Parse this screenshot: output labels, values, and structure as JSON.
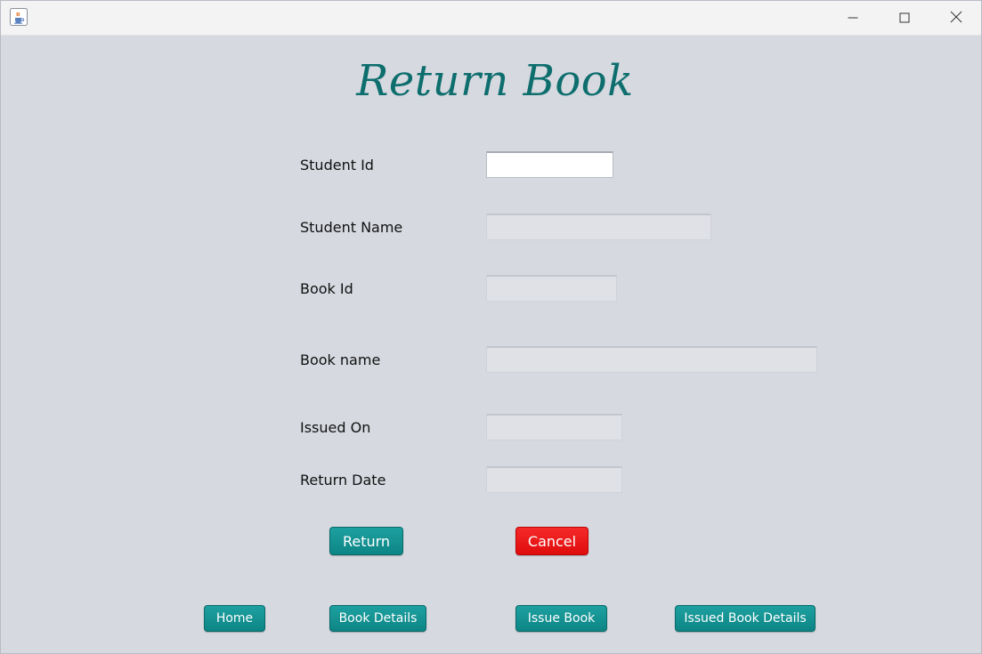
{
  "titlebar": {
    "app_icon": "java-cup-icon",
    "controls": [
      "minimize-icon",
      "maximize-icon",
      "close-icon"
    ]
  },
  "header": {
    "title": "Return Book"
  },
  "form": {
    "student_id": {
      "label": "Student Id",
      "value": ""
    },
    "student_name": {
      "label": "Student Name",
      "value": ""
    },
    "book_id": {
      "label": "Book Id",
      "value": ""
    },
    "book_name": {
      "label": "Book name",
      "value": ""
    },
    "issued_on": {
      "label": "Issued On",
      "value": ""
    },
    "return_date": {
      "label": "Return Date",
      "value": ""
    }
  },
  "actions": {
    "return_label": "Return",
    "cancel_label": "Cancel"
  },
  "nav": {
    "home": "Home",
    "book_details": "Book Details",
    "issue_book": "Issue Book",
    "issued_book_details": "Issued Book Details"
  },
  "colors": {
    "accent_teal": "#0d8585",
    "cancel_red": "#e00c0c",
    "title_teal": "#0e6e6e",
    "background": "#d6d9e0"
  }
}
